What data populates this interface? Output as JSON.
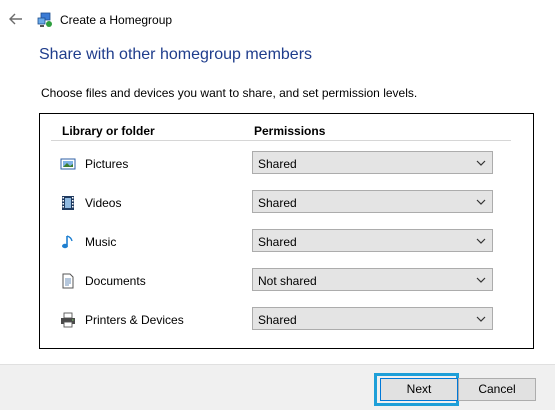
{
  "window": {
    "title": "Create a Homegroup",
    "back_icon": "back-arrow-icon",
    "app_icon": "homegroup-icon"
  },
  "page": {
    "heading": "Share with other homegroup members",
    "instructions": "Choose files and devices you want to share, and set permission levels."
  },
  "table": {
    "headers": {
      "library": "Library or folder",
      "permissions": "Permissions"
    },
    "rows": [
      {
        "label": "Pictures",
        "icon": "pictures-icon",
        "permission": "Shared"
      },
      {
        "label": "Videos",
        "icon": "videos-icon",
        "permission": "Shared"
      },
      {
        "label": "Music",
        "icon": "music-icon",
        "permission": "Shared"
      },
      {
        "label": "Documents",
        "icon": "documents-icon",
        "permission": "Not shared"
      },
      {
        "label": "Printers & Devices",
        "icon": "printer-icon",
        "permission": "Shared"
      }
    ]
  },
  "footer": {
    "next_label": "Next",
    "cancel_label": "Cancel"
  },
  "colors": {
    "heading": "#1f3d8c",
    "highlight": "#1e9fd8",
    "footer_bg": "#f0f0f0"
  }
}
